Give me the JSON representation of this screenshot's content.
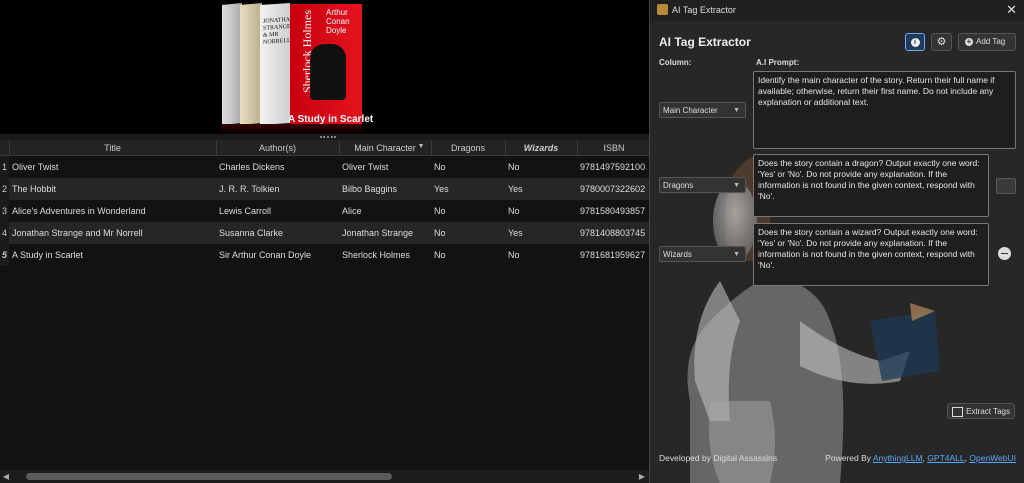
{
  "cover": {
    "book3_text": "JONATHAN STRANGE & MR NORRELL",
    "book4_spine_title": "Sherlock Holmes",
    "book4_author": "Arthur Conan Doyle",
    "caption": "A Study in Scarlet"
  },
  "table": {
    "columns": [
      "Title",
      "Author(s)",
      "Main Character",
      "Dragons",
      "Wizards",
      "ISBN"
    ],
    "rows": [
      {
        "num": "1",
        "title": "Oliver Twist",
        "author": "Charles Dickens",
        "character": "Oliver Twist",
        "dragons": "No",
        "wizards": "No",
        "isbn": "9781497592100"
      },
      {
        "num": "2",
        "title": "The Hobbit",
        "author": "J. R. R. Tolkien",
        "character": "Bilbo Baggins",
        "dragons": "Yes",
        "wizards": "Yes",
        "isbn": "9780007322602"
      },
      {
        "num": "3",
        "title": "Alice's Adventures in Wonderland",
        "author": "Lewis Carroll",
        "character": "Alice",
        "dragons": "No",
        "wizards": "No",
        "isbn": "9781580493857"
      },
      {
        "num": "4",
        "title": "Jonathan Strange and Mr Norrell",
        "author": "Susanna Clarke",
        "character": "Jonathan Strange",
        "dragons": "No",
        "wizards": "Yes",
        "isbn": "9781408803745"
      },
      {
        "num": "5",
        "title": "A Study in Scarlet",
        "author": "Sir Arthur Conan Doyle",
        "character": "Sherlock Holmes",
        "dragons": "No",
        "wizards": "No",
        "isbn": "9781681959627"
      }
    ]
  },
  "dialog": {
    "window_title": "AI Tag Extractor",
    "heading": "AI Tag Extractor",
    "add_tag_label": "Add Tag",
    "column_label": "Column:",
    "prompt_label": "A.I Prompt:",
    "tags": [
      {
        "column": "Main Character",
        "prompt": "Identify the main character of the story. Return their full name if available; otherwise, return their first name. Do not include any explanation or additional text."
      },
      {
        "column": "Dragons",
        "prompt": "Does the story contain a dragon? Output exactly one word: 'Yes' or 'No'. Do not provide any explanation. If the information is not found in the given context, respond with 'No'."
      },
      {
        "column": "Wizards",
        "prompt": "Does the story contain a wizard? Output exactly one word: 'Yes' or 'No'. Do not provide any explanation. If the information is not found in the given context, respond with 'No'."
      }
    ],
    "extract_label": "Extract Tags",
    "developer": "Developed by Digital Assassins",
    "powered_by": "Powered By",
    "links": [
      "AnythingLLM",
      "GPT4ALL",
      "OpenWebUI"
    ],
    "link_separator": ","
  },
  "colors": {
    "accent_link": "#5aa8ff",
    "book_red": "#e4141e",
    "info_button": "#1e3a5c"
  },
  "icons": {
    "close": "close-icon",
    "info": "info-icon",
    "settings": "gear-icon",
    "add": "plus-circle-icon",
    "extract": "export-icon",
    "sort": "sort-down-icon"
  }
}
